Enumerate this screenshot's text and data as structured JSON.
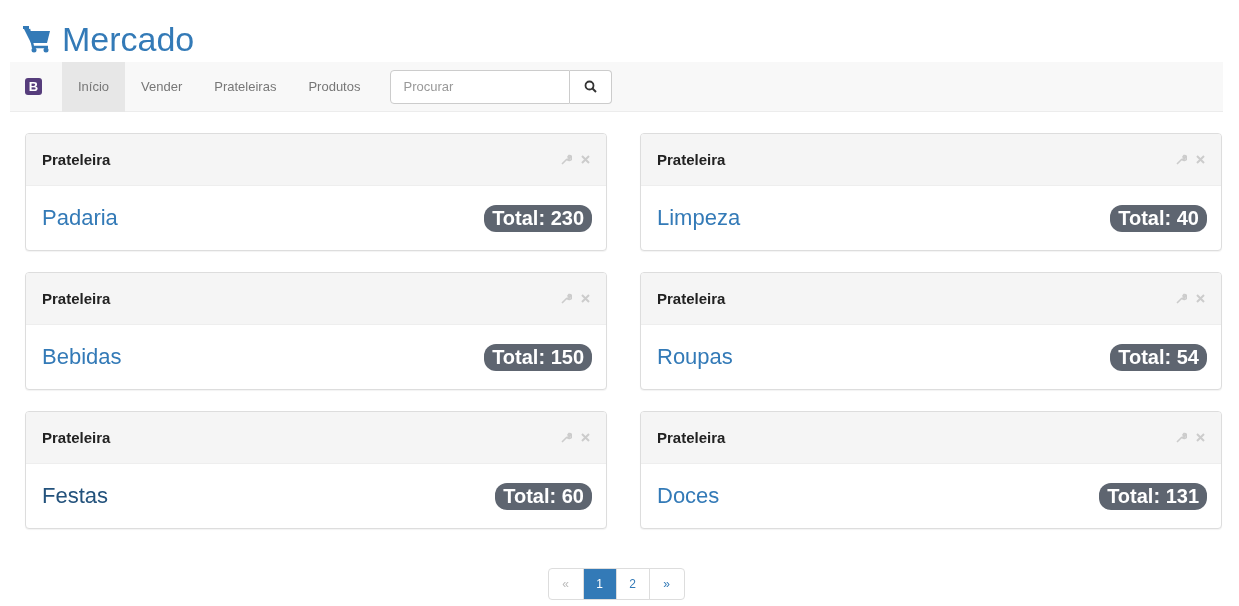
{
  "header": {
    "title": "Mercado"
  },
  "navbar": {
    "brand": "B",
    "items": [
      {
        "label": "Início",
        "selected": true
      },
      {
        "label": "Vender",
        "selected": false
      },
      {
        "label": "Prateleiras",
        "selected": false
      },
      {
        "label": "Produtos",
        "selected": false
      }
    ],
    "search": {
      "placeholder": "Procurar"
    }
  },
  "shelves": [
    {
      "heading": "Prateleira",
      "name": "Padaria",
      "total": "Total: 230",
      "hovered": false
    },
    {
      "heading": "Prateleira",
      "name": "Limpeza",
      "total": "Total: 40",
      "hovered": false
    },
    {
      "heading": "Prateleira",
      "name": "Bebidas",
      "total": "Total: 150",
      "hovered": false
    },
    {
      "heading": "Prateleira",
      "name": "Roupas",
      "total": "Total: 54",
      "hovered": false
    },
    {
      "heading": "Prateleira",
      "name": "Festas",
      "total": "Total: 60",
      "hovered": true
    },
    {
      "heading": "Prateleira",
      "name": "Doces",
      "total": "Total: 131",
      "hovered": false
    }
  ],
  "pagination": [
    {
      "label": "«",
      "selected": false,
      "disabled": true
    },
    {
      "label": "1",
      "selected": true,
      "disabled": false
    },
    {
      "label": "2",
      "selected": false,
      "disabled": false
    },
    {
      "label": "»",
      "selected": false,
      "disabled": false
    }
  ]
}
